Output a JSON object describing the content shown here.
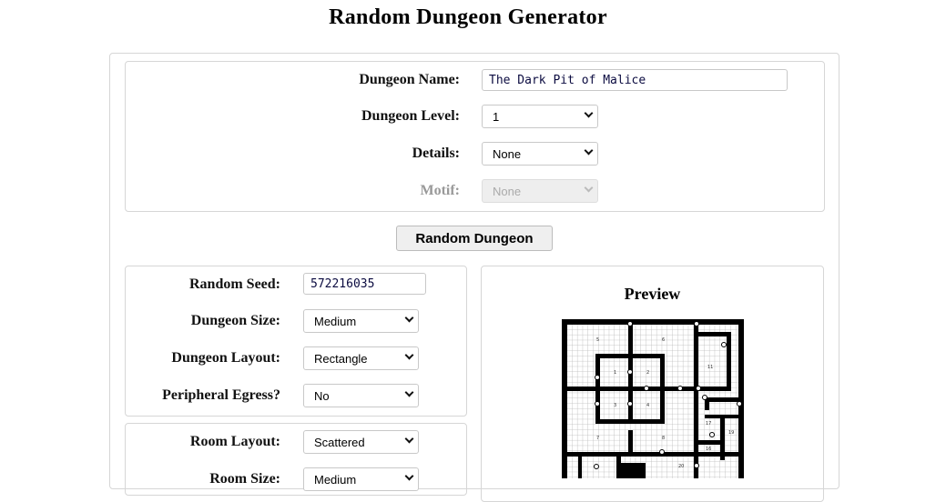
{
  "title": "Random Dungeon Generator",
  "general": {
    "name_label": "Dungeon Name:",
    "name_value": "The Dark Pit of Malice",
    "level_label": "Dungeon Level:",
    "level_value": "1",
    "details_label": "Details:",
    "details_value": "None",
    "motif_label": "Motif:",
    "motif_value": "None"
  },
  "random_button": "Random Dungeon",
  "dungeon": {
    "seed_label": "Random Seed:",
    "seed_value": "572216035",
    "size_label": "Dungeon Size:",
    "size_value": "Medium",
    "layout_label": "Dungeon Layout:",
    "layout_value": "Rectangle",
    "egress_label": "Peripheral Egress?",
    "egress_value": "No"
  },
  "rooms": {
    "layout_label": "Room Layout:",
    "layout_value": "Scattered",
    "size_label": "Room Size:",
    "size_value": "Medium"
  },
  "preview": {
    "title": "Preview",
    "room_numbers": [
      "5",
      "6",
      "1",
      "2",
      "3",
      "4",
      "7",
      "8",
      "11",
      "17",
      "19",
      "16",
      "20"
    ]
  }
}
